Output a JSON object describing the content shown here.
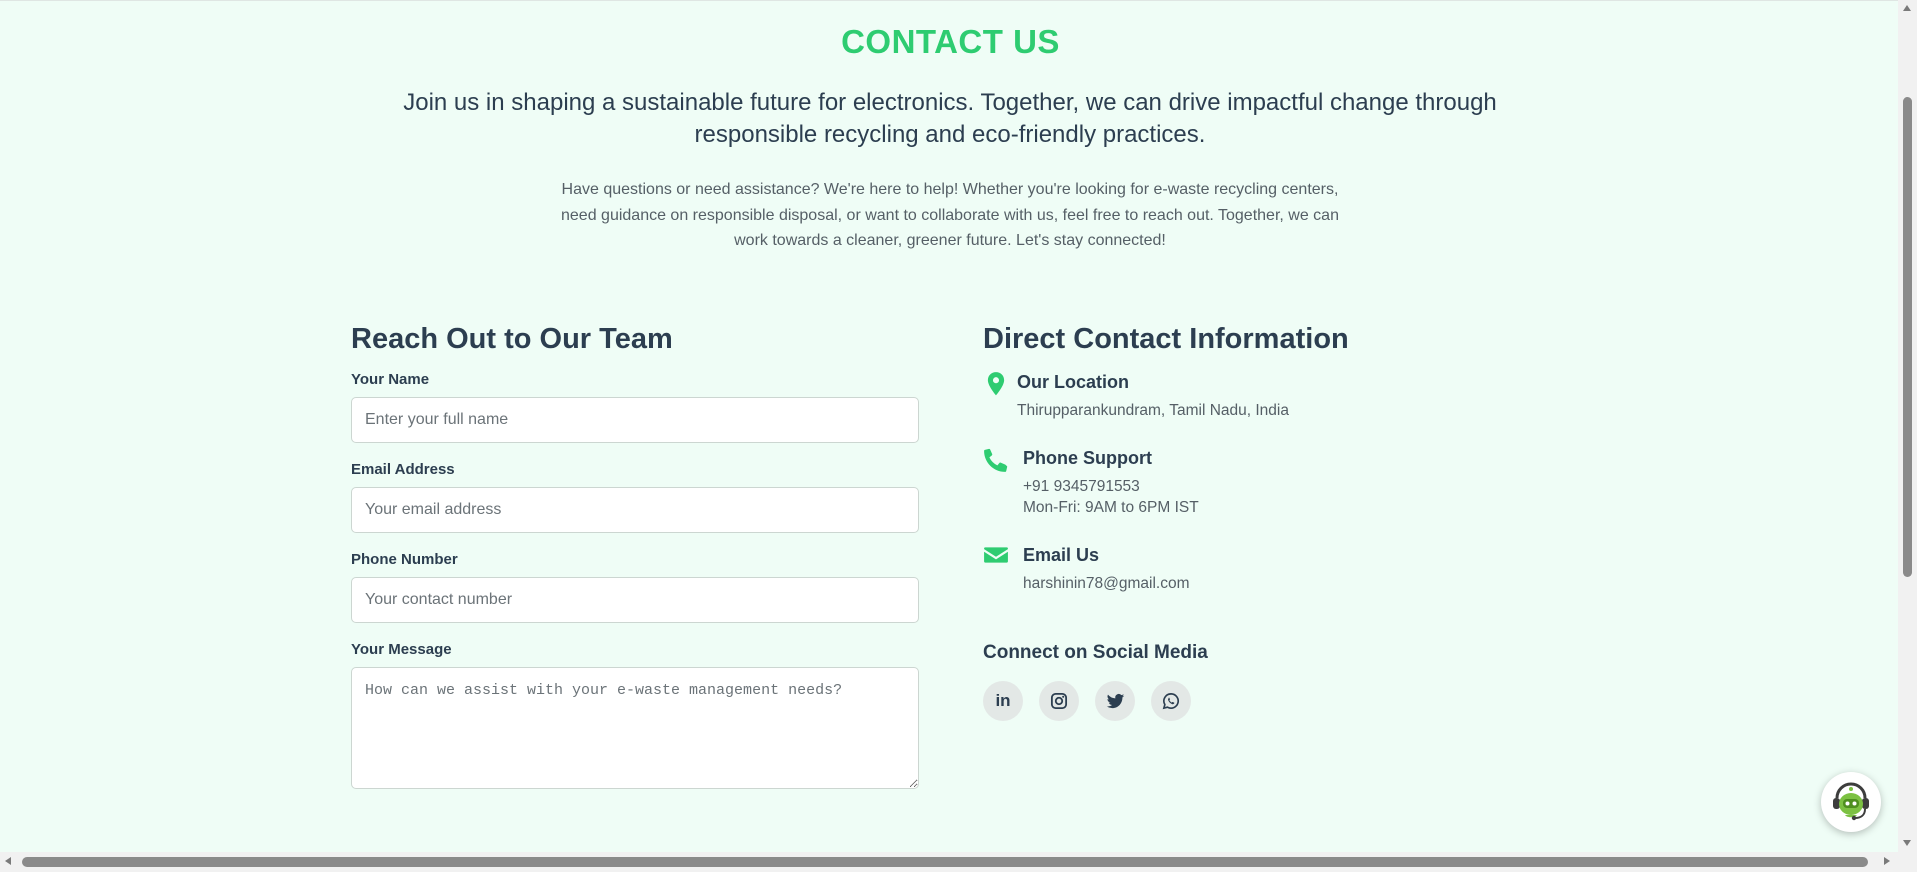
{
  "header": {
    "title": "CONTACT US",
    "lead": "Join us in shaping a sustainable future for electronics. Together, we can drive impactful change through responsible recycling and eco-friendly practices.",
    "description": "Have questions or need assistance? We're here to help! Whether you're looking for e-waste recycling centers, need guidance on responsible disposal, or want to collaborate with us, feel free to reach out. Together, we can work towards a cleaner, greener future. Let's stay connected!"
  },
  "form": {
    "heading": "Reach Out to Our Team",
    "name": {
      "label": "Your Name",
      "placeholder": "Enter your full name",
      "value": ""
    },
    "email": {
      "label": "Email Address",
      "placeholder": "Your email address",
      "value": ""
    },
    "phone": {
      "label": "Phone Number",
      "placeholder": "Your contact number",
      "value": ""
    },
    "message": {
      "label": "Your Message",
      "placeholder": "How can we assist with your e-waste management needs?",
      "value": ""
    }
  },
  "contact": {
    "heading": "Direct Contact Information",
    "location": {
      "title": "Our Location",
      "text": "Thirupparankundram, Tamil Nadu, India",
      "icon": "map-marker-icon"
    },
    "phone": {
      "title": "Phone Support",
      "number": "+91 9345791553",
      "hours": "Mon-Fri: 9AM to 6PM IST",
      "icon": "phone-icon"
    },
    "email": {
      "title": "Email Us",
      "address": "harshinin78@gmail.com",
      "icon": "envelope-icon"
    },
    "social": {
      "heading": "Connect on Social Media",
      "links": [
        {
          "name": "linkedin",
          "glyph": "in",
          "icon": "linkedin-icon"
        },
        {
          "name": "instagram",
          "icon": "instagram-icon"
        },
        {
          "name": "twitter",
          "icon": "twitter-icon"
        },
        {
          "name": "whatsapp",
          "icon": "whatsapp-icon"
        }
      ]
    }
  },
  "colors": {
    "accent": "#2ecc71",
    "text": "#2c3e50",
    "background": "#effdf6",
    "muted": "#555f66"
  }
}
